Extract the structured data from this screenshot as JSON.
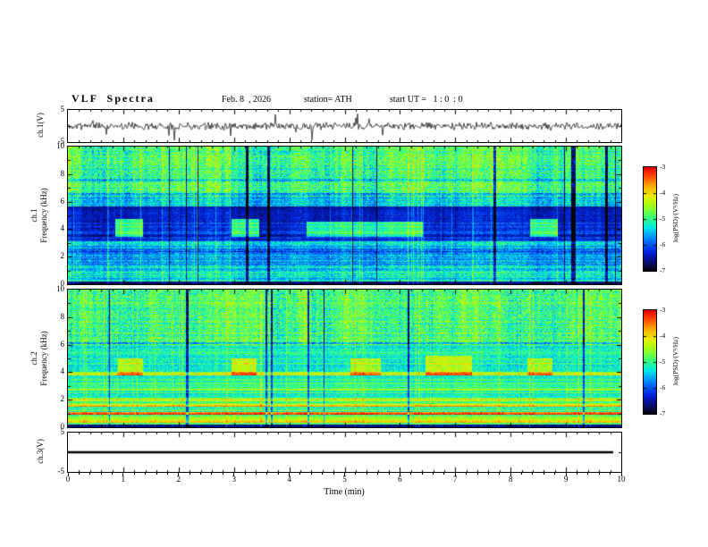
{
  "title": "VLF  Spectra",
  "header": {
    "date": "Feb. 8  , 2026",
    "station": "station= ATH",
    "start_ut": "start UT =   1 : 0  : 0"
  },
  "xaxis": {
    "label": "Time (min)",
    "ticks": [
      0,
      1,
      2,
      3,
      4,
      5,
      6,
      7,
      8,
      9,
      10
    ],
    "range": [
      0,
      10
    ],
    "minor_per_major": 5
  },
  "colorbar": {
    "label": "log(PSD)/(V²/Hz)",
    "ticks": [
      -3,
      -4,
      -5,
      -6,
      -7
    ],
    "range": [
      -7,
      -3
    ]
  },
  "style": {
    "background": "#ffffff",
    "frame_color": "#000000",
    "colormap": [
      [
        0.0,
        5,
        5,
        5
      ],
      [
        0.06,
        10,
        10,
        80
      ],
      [
        0.18,
        0,
        30,
        220
      ],
      [
        0.3,
        0,
        120,
        255
      ],
      [
        0.42,
        0,
        230,
        230
      ],
      [
        0.52,
        60,
        255,
        120
      ],
      [
        0.62,
        150,
        255,
        30
      ],
      [
        0.72,
        230,
        240,
        0
      ],
      [
        0.82,
        255,
        170,
        0
      ],
      [
        0.92,
        255,
        70,
        0
      ],
      [
        1.0,
        230,
        0,
        0
      ]
    ]
  },
  "chart_data": [
    {
      "id": "ch1_wave",
      "type": "line",
      "ylabel": "ch.1(V)",
      "ylim": [
        -5,
        5
      ],
      "yticks": [
        5,
        -5
      ],
      "yticks_minor": [
        0
      ],
      "xlim": [
        0,
        10
      ],
      "seed": 11,
      "noise_amp": 0.9,
      "spike_prob": 0.02,
      "spike_amp": 2.8,
      "line_width": 0.7,
      "description": "noisy broadband voltage trace around 0 V with impulsive spikes"
    },
    {
      "id": "ch1_spec",
      "type": "heatmap",
      "ylabel_lines": [
        "ch.1",
        "Frequency (kHz)"
      ],
      "ylim": [
        0,
        10
      ],
      "yticks": [
        0,
        2,
        4,
        6,
        8,
        10
      ],
      "yticks_minor": [
        1,
        3,
        5,
        7,
        9
      ],
      "xlim": [
        0,
        10
      ],
      "vmin": -7,
      "vmax": -3,
      "seed": 71,
      "streak_split": 5.7,
      "streak_hi": 1.0,
      "streak_lo": 0.55,
      "dropout_prob": 0.012,
      "bright_prob": 0.05,
      "bands": [
        {
          "f0": 0,
          "f1": 0.25,
          "base": 0.1,
          "rvar": 0.04,
          "nvar": 0.05
        },
        {
          "f0": 0.25,
          "f1": 1.35,
          "base": 0.42,
          "rvar": 0.07,
          "nvar": 0.1
        },
        {
          "f0": 1.35,
          "f1": 3.15,
          "base": 0.35,
          "rvar": 0.09,
          "nvar": 0.1
        },
        {
          "f0": 3.15,
          "f1": 4.5,
          "base": 0.2,
          "rvar": 0.05,
          "nvar": 0.07
        },
        {
          "f0": 4.5,
          "f1": 5.7,
          "base": 0.15,
          "rvar": 0.05,
          "nvar": 0.06
        },
        {
          "f0": 5.7,
          "f1": 6.4,
          "base": 0.4,
          "rvar": 0.06,
          "nvar": 0.1
        },
        {
          "f0": 6.4,
          "f1": 10.01,
          "base": 0.52,
          "rvar": 0.05,
          "nvar": 0.13
        }
      ],
      "hlines": [
        {
          "f": 2.45,
          "w": 0.18,
          "boost": -0.1
        },
        {
          "f": 3.6,
          "w": 0.1,
          "boost": -0.05
        },
        {
          "f": 6.55,
          "w": 0.08,
          "boost": -0.18
        },
        {
          "f": 7.6,
          "w": 0.07,
          "boost": -0.12
        }
      ],
      "events": [
        {
          "t0": 0.85,
          "t1": 1.35,
          "f0": 3.5,
          "f1": 4.8,
          "boost": 0.34
        },
        {
          "t0": 2.95,
          "t1": 3.45,
          "f0": 3.5,
          "f1": 4.8,
          "boost": 0.34
        },
        {
          "t0": 4.3,
          "t1": 6.4,
          "f0": 3.5,
          "f1": 4.6,
          "boost": 0.3
        },
        {
          "t0": 8.35,
          "t1": 8.85,
          "f0": 3.5,
          "f1": 4.8,
          "boost": 0.34
        }
      ]
    },
    {
      "id": "ch2_spec",
      "type": "heatmap",
      "ylabel_lines": [
        "ch.2",
        "Frequency (kHz)"
      ],
      "ylim": [
        0,
        10
      ],
      "yticks": [
        0,
        2,
        4,
        6,
        8,
        10
      ],
      "yticks_minor": [
        1,
        3,
        5,
        7,
        9
      ],
      "xlim": [
        0,
        10
      ],
      "vmin": -7,
      "vmax": -3,
      "seed": 37,
      "streak_split": 6.0,
      "streak_hi": 1.0,
      "streak_lo": 0.4,
      "dropout_prob": 0.01,
      "bright_prob": 0.05,
      "bands": [
        {
          "f0": 0,
          "f1": 0.25,
          "base": 0.1,
          "rvar": 0.04,
          "nvar": 0.05
        },
        {
          "f0": 0.25,
          "f1": 2.35,
          "base": 0.55,
          "rvar": 0.13,
          "nvar": 0.08
        },
        {
          "f0": 2.35,
          "f1": 4.05,
          "base": 0.5,
          "rvar": 0.09,
          "nvar": 0.08
        },
        {
          "f0": 4.05,
          "f1": 6.0,
          "base": 0.46,
          "rvar": 0.05,
          "nvar": 0.09
        },
        {
          "f0": 6.0,
          "f1": 10.01,
          "base": 0.52,
          "rvar": 0.05,
          "nvar": 0.13
        }
      ],
      "hlines": [
        {
          "f": 0.45,
          "w": 0.12,
          "boost": 0.22
        },
        {
          "f": 1.05,
          "w": 0.1,
          "boost": 0.28
        },
        {
          "f": 1.6,
          "w": 0.09,
          "boost": 0.24
        },
        {
          "f": 2.0,
          "w": 0.08,
          "boost": 0.2
        },
        {
          "f": 2.75,
          "w": 0.08,
          "boost": 0.12
        },
        {
          "f": 3.9,
          "w": 0.09,
          "boost": 0.16
        },
        {
          "f": 6.15,
          "w": 0.07,
          "boost": -0.16
        }
      ],
      "events": [
        {
          "t0": 0.9,
          "t1": 1.35,
          "f0": 3.8,
          "f1": 5.0,
          "boost": 0.22
        },
        {
          "t0": 2.95,
          "t1": 3.4,
          "f0": 3.8,
          "f1": 5.0,
          "boost": 0.22
        },
        {
          "t0": 5.1,
          "t1": 5.65,
          "f0": 3.8,
          "f1": 5.0,
          "boost": 0.2
        },
        {
          "t0": 6.45,
          "t1": 7.3,
          "f0": 3.8,
          "f1": 5.2,
          "boost": 0.22
        },
        {
          "t0": 8.3,
          "t1": 8.75,
          "f0": 3.8,
          "f1": 5.0,
          "boost": 0.2
        }
      ]
    },
    {
      "id": "ch3_wave",
      "type": "line",
      "ylabel": "ch.3(V)",
      "ylim": [
        -5,
        5
      ],
      "yticks": [
        5,
        -5
      ],
      "yticks_minor": [
        0
      ],
      "xlim": [
        0,
        10
      ],
      "seed": 5,
      "flat_value": 0,
      "t_end": 9.85,
      "line_width": 2.5,
      "description": "flat zero-signal trace (channel off)"
    }
  ]
}
